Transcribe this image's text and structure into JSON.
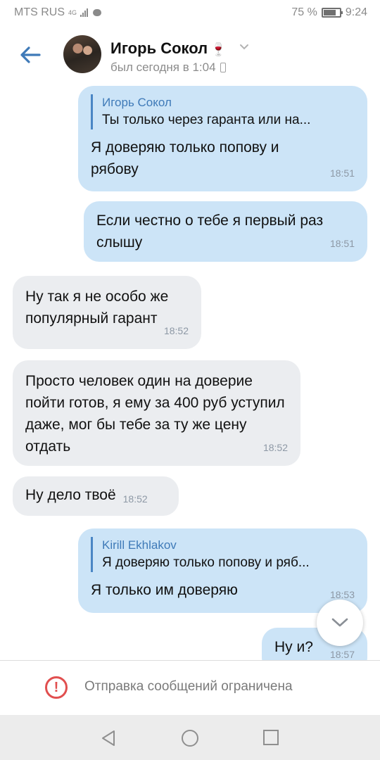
{
  "status_bar": {
    "carrier": "MTS RUS",
    "network_label": "4G",
    "battery": "75 %",
    "battery_level": 0.75,
    "time": "9:24"
  },
  "header": {
    "contact_name": "Игорь Сокол",
    "name_emoji": "🍷",
    "last_seen": "был сегодня в 1:04"
  },
  "messages": [
    {
      "direction": "out",
      "reply": {
        "author": "Игорь Сокол",
        "text": "Ты только через гаранта или на..."
      },
      "text": "Я доверяю только попову и рябову",
      "time": "18:51"
    },
    {
      "direction": "out",
      "text": "Если честно о тебе я первый раз слышу",
      "time": "18:51"
    },
    {
      "direction": "in",
      "text": "Ну так я не особо же популярный гарант",
      "time": "18:52"
    },
    {
      "direction": "in",
      "text": "Просто человек один на доверие пойти готов, я ему за 400 руб уступил даже, мог бы тебе за ту же цену отдать",
      "time": "18:52"
    },
    {
      "direction": "in",
      "text": "Ну дело твоё",
      "time": "18:52"
    },
    {
      "direction": "out",
      "reply": {
        "author": "Kirill Ekhlakov",
        "text": "Я доверяю только попову и ряб..."
      },
      "text": "Я только им доверяю",
      "time": "18:53"
    },
    {
      "direction": "out",
      "text": "Ну и?",
      "time": "18:57"
    }
  ],
  "restriction": {
    "text": "Отправка сообщений ограничена"
  },
  "colors": {
    "accent": "#3f7ab8",
    "outgoing_bubble": "#cce4f7",
    "incoming_bubble": "#ebedf0",
    "warning": "#e14f4f"
  }
}
